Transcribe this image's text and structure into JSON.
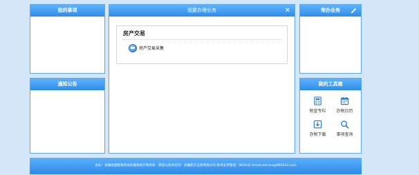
{
  "colors": {
    "page_bg": "#d4e7f8",
    "panel_border": "#5aa7ee",
    "header_top": "#5fb2fb",
    "header_bottom": "#2e8de9",
    "icon_blue": "#2a7ed8"
  },
  "panels": {
    "my_matters": {
      "title": "我的事项"
    },
    "notice": {
      "title": "通知公告"
    },
    "main": {
      "title": "我要办理业务",
      "close_icon": "close-icon",
      "category": {
        "title": "房产交易",
        "items": [
          {
            "label": "房产交易采集",
            "icon": "house-info-icon"
          }
        ]
      }
    },
    "common": {
      "title": "常办业务",
      "edit_icon": "pencil-icon"
    },
    "tools": {
      "title": "我的工具箱",
      "items": [
        {
          "label": "税宣专栏",
          "icon": "calculator-icon"
        },
        {
          "label": "办税日历",
          "icon": "calendar-icon"
        },
        {
          "label": "办税下载",
          "icon": "download-icon"
        },
        {
          "label": "事项查询",
          "icon": "search-icon"
        }
      ]
    }
  },
  "footer": {
    "text": "主办：安徽省国家税务局安徽省地方税务局　研发与技术支持：安徽航天信息有限公司 技术支持电话：965432 Email:service@965432.com"
  }
}
